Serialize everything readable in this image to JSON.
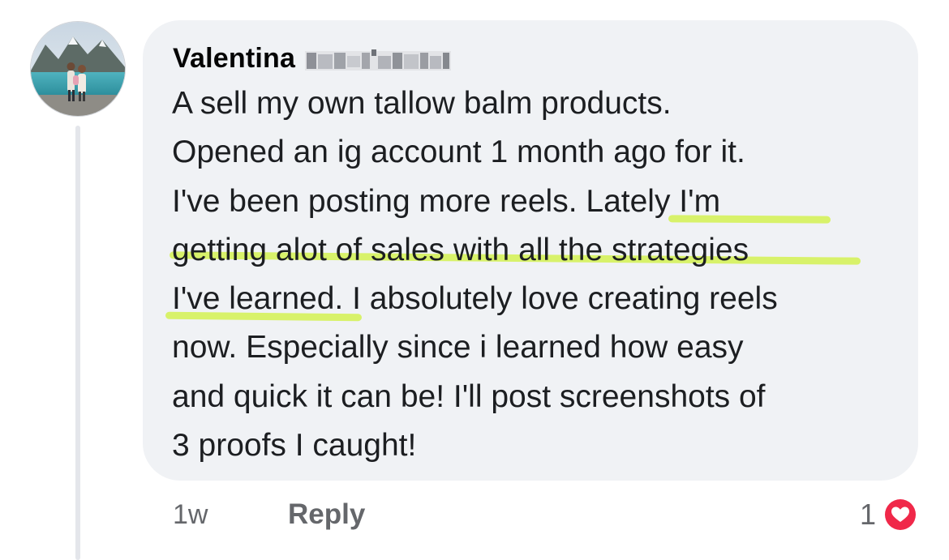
{
  "comment": {
    "author_name": "Valentina",
    "author_surname_redacted": true,
    "text_lines": [
      "A sell my own tallow balm products.",
      "Opened an ig account 1 month ago for it.",
      "I've been posting  more reels. Lately I'm",
      "getting alot of sales with all the strategies",
      "I've learned. I absolutely love creating reels",
      "now. Especially since i learned how easy",
      "and quick it can be! I'll post screenshots of",
      "3 proofs I caught!"
    ],
    "highlighted_phrase": "Lately I'm getting alot of sales with all the strategies I've learned",
    "highlight_color": "#d8f26a"
  },
  "footer": {
    "timestamp": "1w",
    "reply_label": "Reply",
    "reaction_count": "1",
    "reaction_icon": "heart-icon",
    "reaction_color": "#f02849"
  },
  "colors": {
    "bubble_bg": "#f0f2f5",
    "text": "#1c1e21",
    "secondary_text": "#65676b"
  }
}
